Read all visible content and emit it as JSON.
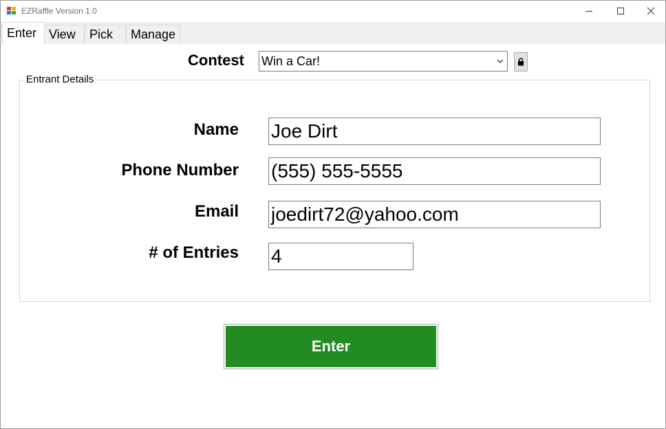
{
  "window": {
    "title": "EZRaffle Version 1.0"
  },
  "tabs": [
    {
      "label": "Enter",
      "active": true
    },
    {
      "label": "View",
      "active": false
    },
    {
      "label": "Pick",
      "active": false
    },
    {
      "label": "Manage",
      "active": false
    }
  ],
  "contest": {
    "label": "Contest",
    "selected": "Win a Car!",
    "lock_icon": "lock-icon"
  },
  "entrant_details": {
    "group_title": "Entrant Details",
    "name_label": "Name",
    "name_value": "Joe Dirt",
    "phone_label": "Phone Number",
    "phone_value": "(555) 555-5555",
    "email_label": "Email",
    "email_value": "joedirt72@yahoo.com",
    "entries_label": "# of Entries",
    "entries_value": "4"
  },
  "enter_button": {
    "label": "Enter",
    "color": "#228b22"
  },
  "colors": {
    "tab_strip": "#f0f0f0",
    "border": "#7a7a7a"
  }
}
